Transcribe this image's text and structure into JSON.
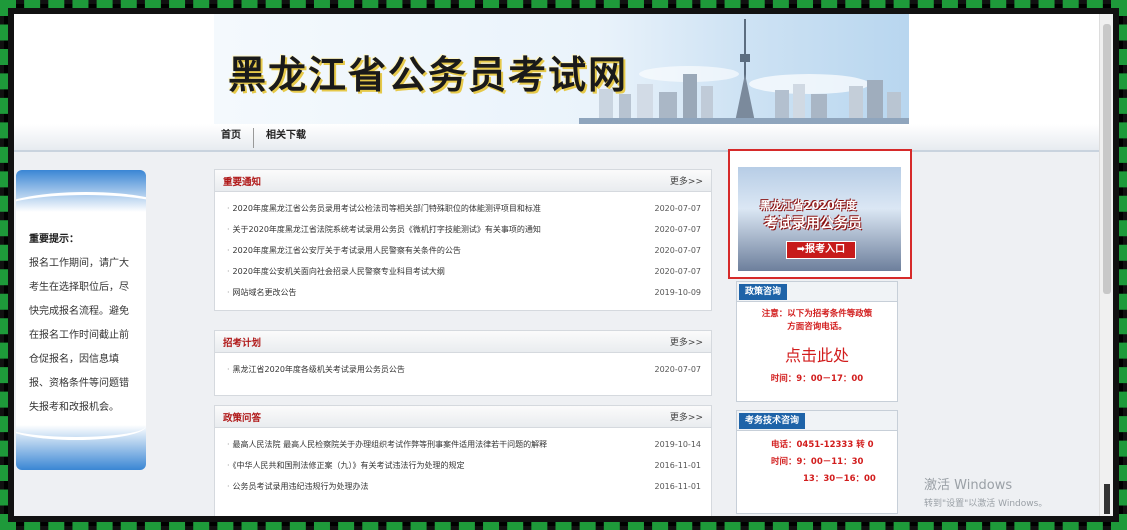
{
  "header": {
    "site_title": "黑龙江省公务员考试网",
    "nav": [
      "首页",
      "相关下载"
    ]
  },
  "notice_panel": {
    "title": "重要提示：",
    "lines": [
      "报名工作期间，请广大",
      "考生在选择职位后，尽",
      "快完成报名流程。避免",
      "在报名工作时间截止前",
      "仓促报名，因信息填",
      "报、资格条件等问题错",
      "失报考和改报机会。"
    ]
  },
  "sections": [
    {
      "title": "重要通知",
      "more": "更多>>",
      "rows": [
        {
          "text": "2020年度黑龙江省公务员录用考试公检法司等相关部门特殊职位的体能测评项目和标准",
          "date": "2020-07-07"
        },
        {
          "text": "关于2020年度黑龙江省法院系统考试录用公务员《微机打字技能测试》有关事项的通知",
          "date": "2020-07-07"
        },
        {
          "text": "2020年度黑龙江省公安厅关于考试录用人民警察有关条件的公告",
          "date": "2020-07-07"
        },
        {
          "text": "2020年度公安机关面向社会招录人民警察专业科目考试大纲",
          "date": "2020-07-07"
        },
        {
          "text": "网站域名更改公告",
          "date": "2019-10-09"
        }
      ]
    },
    {
      "title": "招考计划",
      "more": "更多>>",
      "rows": [
        {
          "text": "黑龙江省2020年度各级机关考试录用公务员公告",
          "date": "2020-07-07"
        }
      ]
    },
    {
      "title": "政策问答",
      "more": "更多>>",
      "rows": [
        {
          "text": "最高人民法院 最高人民检察院关于办理组织考试作弊等刑事案件适用法律若干问题的解释",
          "date": "2019-10-14"
        },
        {
          "text": "《中华人民共和国刑法修正案（九）》有关考试违法行为处理的规定",
          "date": "2016-11-01"
        },
        {
          "text": "公务员考试录用违纪违规行为处理办法",
          "date": "2016-11-01"
        }
      ]
    }
  ],
  "promo": {
    "line1": "黑龙江省2020年度",
    "line2": "考试录用公务员",
    "button": "➡报考入口"
  },
  "policy_box": {
    "tag": "政策咨询",
    "note_line1": "注意：以下为招考条件等政策",
    "note_line2": "方面咨询电话。",
    "link": "点击此处",
    "hours": "时间：9：00－17：00"
  },
  "tech_box": {
    "tag": "考务技术咨询",
    "phone": "电话：0451-12333 转 0",
    "hours1": "时间：9：00－11：30",
    "hours2": "13：30－16：00"
  },
  "watermark": {
    "line1": "激活 Windows",
    "line2": "转到\"设置\"以激活 Windows。"
  },
  "colors": {
    "frame_green": "#1e9a3a",
    "accent_red": "#d21d1d",
    "tag_blue": "#1e63a8"
  }
}
